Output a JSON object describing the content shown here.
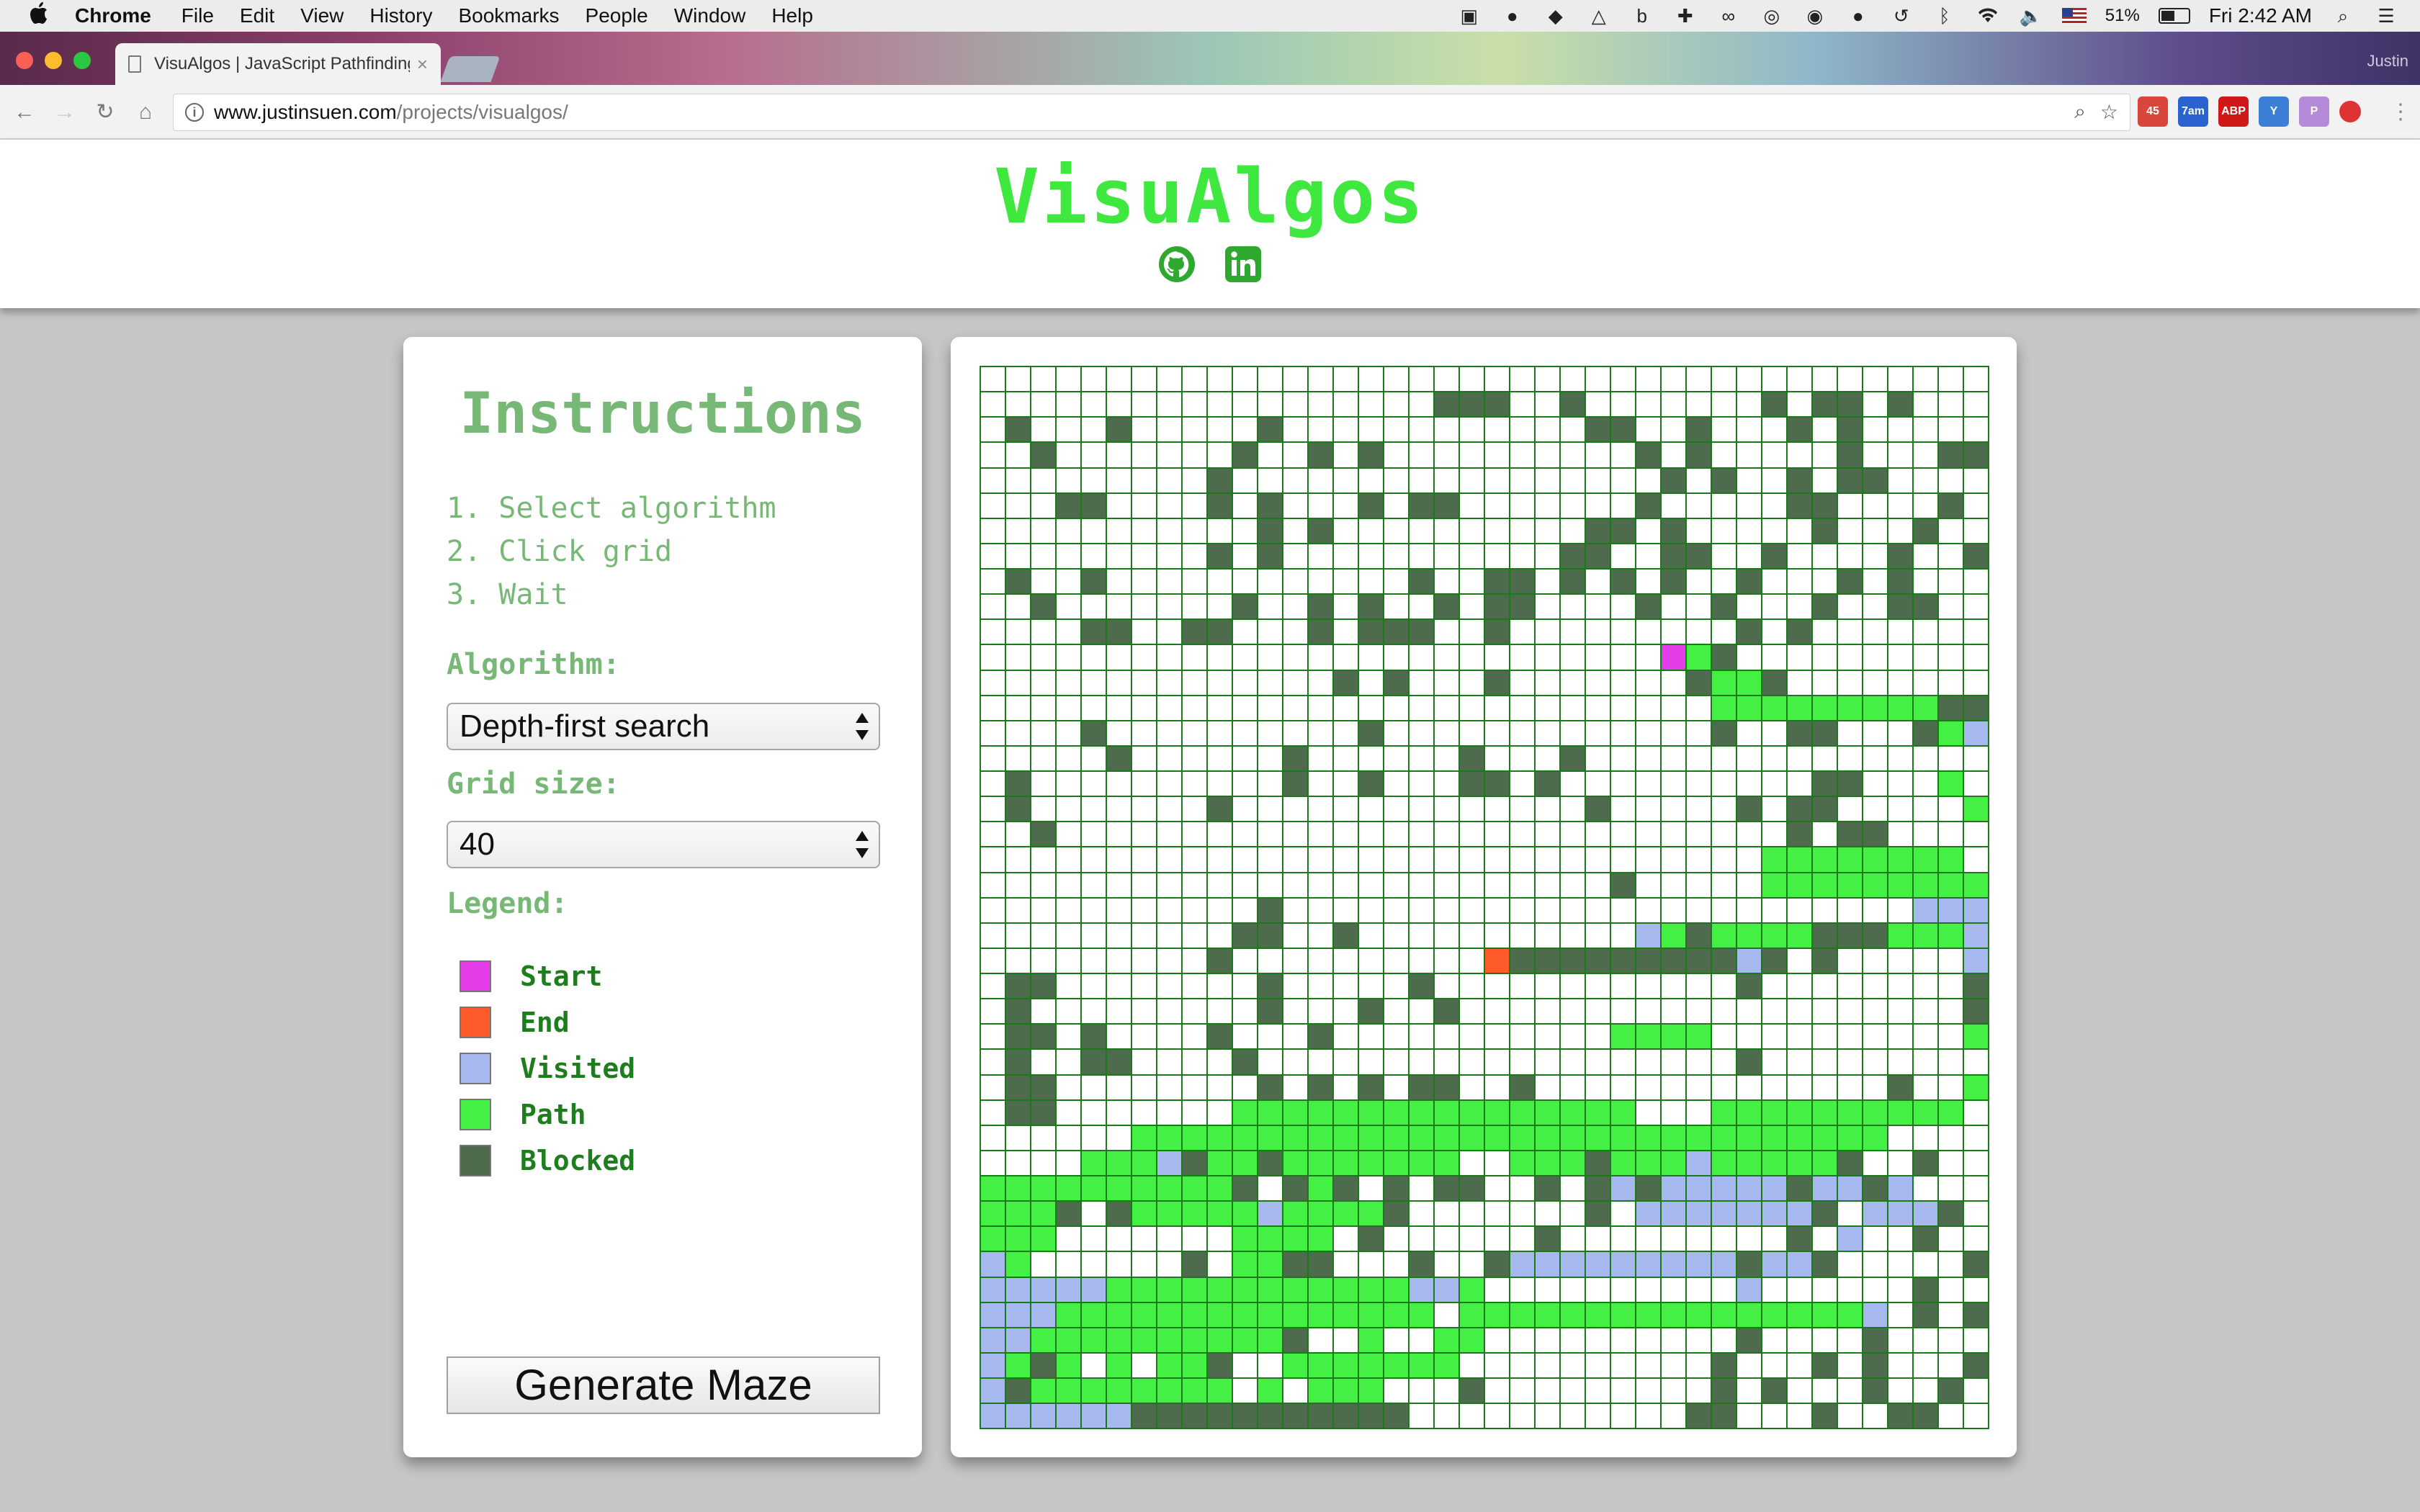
{
  "menubar": {
    "app_name": "Chrome",
    "items": [
      "File",
      "Edit",
      "View",
      "History",
      "Bookmarks",
      "People",
      "Window",
      "Help"
    ],
    "battery": "51%",
    "battery_level": 0.51,
    "clock": "Fri 2:42 AM"
  },
  "browser": {
    "tab_title": "VisuAlgos | JavaScript Pathfinding",
    "tab_close": "×",
    "profile_name": "Justin",
    "url_host": "www.justinsuen.com",
    "url_path": "/projects/visualgos/",
    "extensions": [
      {
        "name": "gmail-badge",
        "label": "45",
        "color": "#d9463b"
      },
      {
        "name": "calendar-badge",
        "label": "7am",
        "color": "#2a63d0"
      },
      {
        "name": "adblock-badge",
        "label": "ABP",
        "color": "#d01818"
      },
      {
        "name": "extension-y",
        "label": "Y",
        "color": "#3b7fd6"
      },
      {
        "name": "extension-p",
        "label": "P",
        "color": "#b58ad9"
      },
      {
        "name": "extension-rec",
        "label": "",
        "color": "#d33"
      }
    ]
  },
  "site": {
    "title": "VisuAlgos"
  },
  "instructions": {
    "title": "Instructions",
    "steps": [
      "1. Select algorithm",
      "2. Click grid",
      "3. Wait"
    ],
    "algorithm_label": "Algorithm:",
    "algorithm_value": "Depth-first search",
    "grid_size_label": "Grid size:",
    "grid_size_value": "40",
    "legend_label": "Legend:",
    "legend": [
      {
        "key": "start",
        "label": "Start",
        "color": "#e33ce8"
      },
      {
        "key": "end",
        "label": "End",
        "color": "#ff5a2a"
      },
      {
        "key": "visited",
        "label": "Visited",
        "color": "#a6b8ee"
      },
      {
        "key": "path",
        "label": "Path",
        "color": "#44f044"
      },
      {
        "key": "blocked",
        "label": "Blocked",
        "color": "#4e6b4e"
      }
    ],
    "generate_button": "Generate Maze"
  },
  "grid": {
    "columns": 40,
    "rows": 42,
    "colors": {
      ".": "#ffffff",
      "#": "#4e6b4e",
      "p": "#44f044",
      "v": "#a6b8ee",
      "S": "#e33ce8",
      "E": "#ff5a2a"
    },
    "cells": [
      "........................................",
      "..................###..#.......#.##.#...",
      ".#...#.....#............##..#...#.#.....",
      "..#.......#..#.#..........#.#.....#...##",
      ".........#.................#.#..#.##....",
      "...##....#.#...#.##.......#.....##....#.",
      "...........#.#..........##.#.....#...#..",
      ".........#.#...........##..##..#....#..#",
      ".#..#............#..##.#.#.#..#...#.#...",
      "..#.......#..#.#..#.##....#..#...#..##..",
      "....##..##...#.###..#.........#.#.......",
      "...........................Sp#..........",
      "..............#.#...#.......#pp#........",
      ".............................ppppppppp##",
      "....#..........#.............#..##...#pv",
      ".....#......#......#...#.................",
      ".#..........#..#...##.#..........##...p.",
      ".#.......#..............#.....#.##.....p",
      "..#.............................#.##....",
      "...............................pppppppp",
      ".........................#.....ppppppppp",
      "...........#.........................vvv",
      "..........##..#...........vp#pppp###pppv",
      ".........#..........E#########v#.#.....v",
      ".##........#.....#............#........#",
      ".#.........#...#..#....................#",
      ".##.#....#...#...........pppp..........p",
      ".#..##....#...................#.........p",
      ".##........#.#.#.##..#..............#..p",
      ".##.......pppppppppppppppp...pppppppppp.",
      "......pppppppppppppppppppppppppppppp....",
      "....pppv#pp#ppppppp..ppp#pppvppppp#..#..",
      "pppppppppp#.#p#.#.##..#.#v#vvvvv#vv#v...",
      "ppp#.#pppppvpppp#.......#.vvvvvvv#.vvv#.",
      "ppp.......pppp.#......#.........#.v..#..",
      "vp......#.pp##...#..#vvvvvvvvv#vv#.....#",
      "vvvvvppppppppppppvvp..........v......#..",
      "vvvppppppppppppppp.ppppppppppppppppv.#.#",
      "vvpppppppppp#..p..pp..........#....#....",
      "vp#p.p.pp#..ppppppp..........#...#.#...#",
      "v#pppppppp.p.ppp...#.........#.#...#..#.",
      "vvvvvv###########...........##...#..##.."
    ]
  }
}
